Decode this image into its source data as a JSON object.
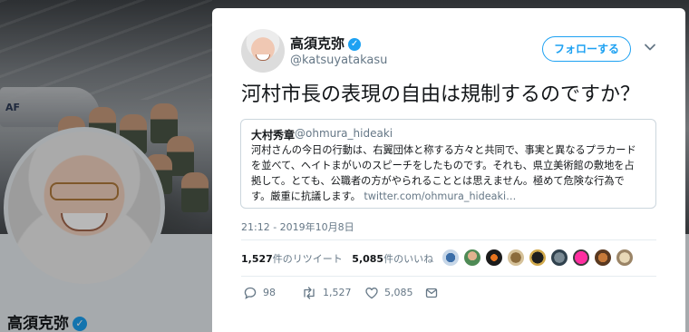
{
  "background_profile": {
    "display_name": "高須克弥",
    "banner_text": "AF",
    "verified_icon": "verified-badge-icon"
  },
  "tweet": {
    "display_name": "高須克弥",
    "handle": "@katsuyatakasu",
    "follow_label": "フォローする",
    "text": "河村市長の表現の自由は規制するのですか？",
    "quoted": {
      "name": "大村秀章",
      "handle": "@ohmura_hideaki",
      "lines": [
        "河村さんの今日の行動は、右翼団体と称する方々と共同で、事実と異なるプラカード",
        "を並べて、ヘイトまがいのスピーチをしたものです。それも、県立美術館の敷地を占",
        "拠して。とても、公職者の方がやられることとは思えません。極めて危険な行為で",
        "す。厳重に抗議します。"
      ],
      "link": "twitter.com/ohmura_hideaki…"
    },
    "timestamp": "21:12 - 2019年10月8日",
    "retweets_count": "1,527",
    "retweets_label": "件のリツイート",
    "likes_count": "5,085",
    "likes_label": "件のいいね",
    "actions": {
      "reply_count": "98",
      "retweet_count": "1,527",
      "like_count": "5,085"
    }
  },
  "colors": {
    "accent": "#1da1f2",
    "muted": "#657786",
    "text": "#14171a",
    "border": "#e6ecf0"
  },
  "icons": [
    "verified-badge-icon",
    "chevron-down-icon",
    "reply-icon",
    "retweet-icon",
    "like-icon",
    "share-icon"
  ]
}
